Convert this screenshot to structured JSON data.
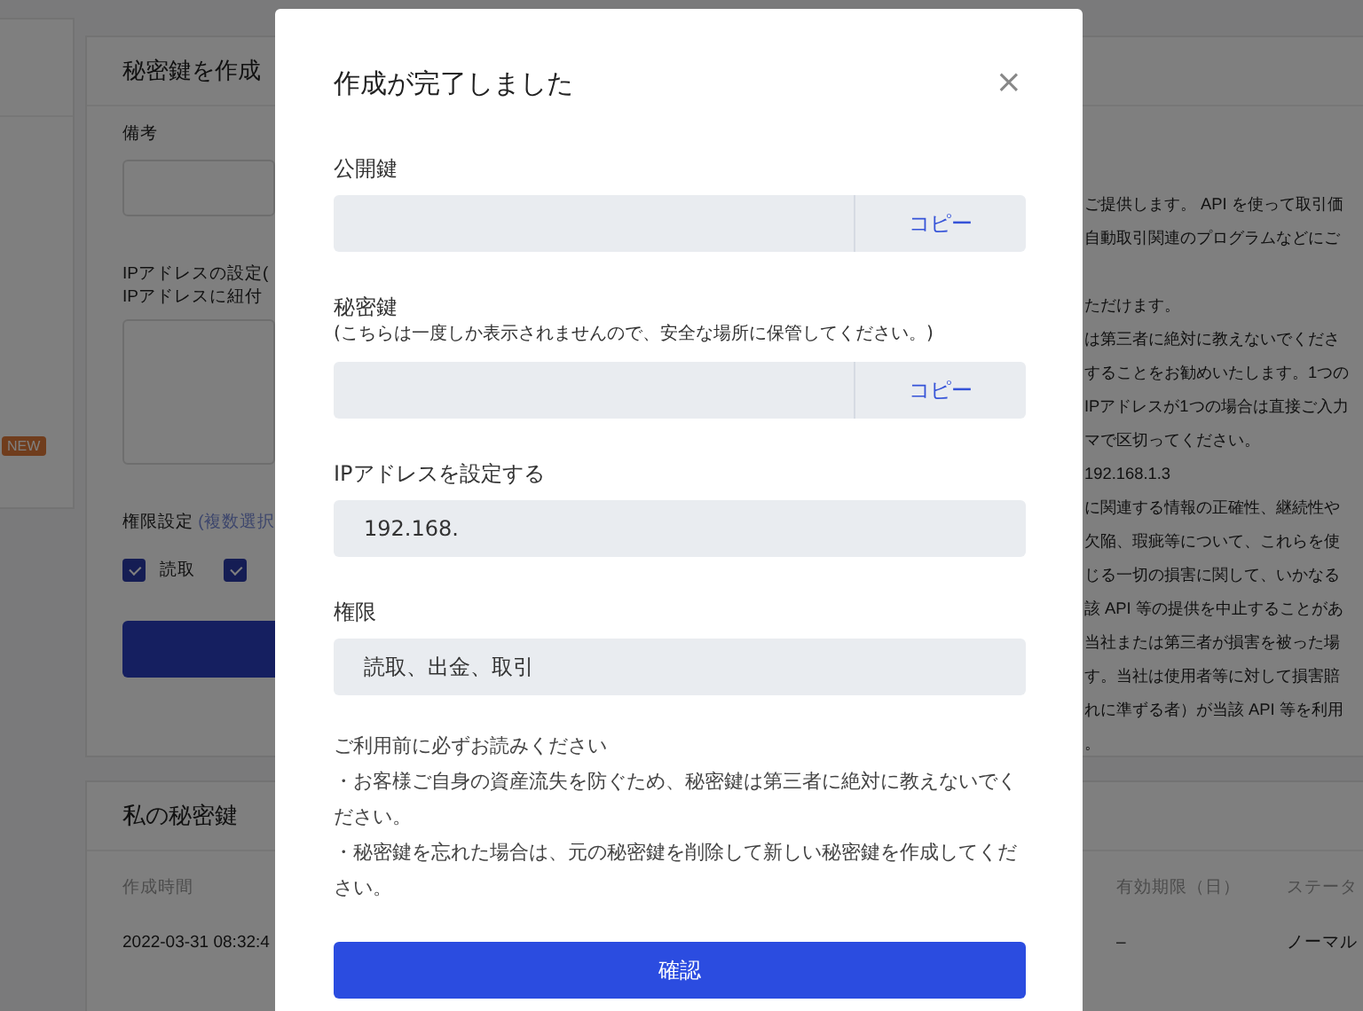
{
  "background": {
    "sidebar": {
      "badge": "NEW"
    },
    "create_card": {
      "title": "秘密鍵を作成",
      "memo_label": "備考",
      "ip_label_lines": [
        "IPアドレスの設定(",
        "IPアドレスに紐付"
      ],
      "permission_label": "権限設定",
      "permission_hint": "(複数選択",
      "permissions": [
        {
          "label": "読取",
          "checked": true
        },
        {
          "checked": true
        }
      ],
      "description": [
        [
          "ご提供します。 API を使って取引価",
          "自動取引関連のプログラムなどにご"
        ],
        [
          "ただけます。",
          "は第三者に絶対に教えないでくださ",
          "することをお勧めいたします。1つの",
          "IPアドレスが1つの場合は直接ご入力",
          "マで区切ってください。",
          "192.168.1.3",
          "に関連する情報の正確性、継続性や",
          "欠陥、瑕疵等について、これらを使",
          "じる一切の損害に関して、いかなる",
          "該 API 等の提供を中止することがあ",
          "当社または第三者が損害を被った場",
          "す。当社は使用者等に対して損害賠",
          "れに準ずる者）が当該 API 等を利用",
          "。"
        ]
      ]
    },
    "keys_card": {
      "title": "私の秘密鍵",
      "columns": [
        "作成時間",
        "有効期限（日）",
        "ステータ"
      ],
      "rows": [
        [
          "2022-03-31 08:32:4",
          "–",
          "ノーマル"
        ]
      ]
    }
  },
  "modal": {
    "title": "作成が完了しました",
    "close": "×",
    "fields": [
      {
        "kind": "copy",
        "label": "公開鍵",
        "button": "コピー"
      },
      {
        "kind": "copy",
        "label": "秘密鍵",
        "note": "(こちらは一度しか表示されませんので、安全な場所に保管してください。)",
        "button": "コピー"
      },
      {
        "kind": "text",
        "label": "IPアドレスを設定する",
        "value": "192.168."
      },
      {
        "kind": "text",
        "label": "権限",
        "value": "読取、出金、取引"
      }
    ],
    "notice": [
      "ご利用前に必ずお読みください",
      "・お客様ご自身の資産流失を防ぐため、秘密鍵は第三者に絶対に教えないでください。",
      "・秘密鍵を忘れた場合は、元の秘密鍵を削除して新しい秘密鍵を作成してください。"
    ],
    "confirm": "確認"
  }
}
